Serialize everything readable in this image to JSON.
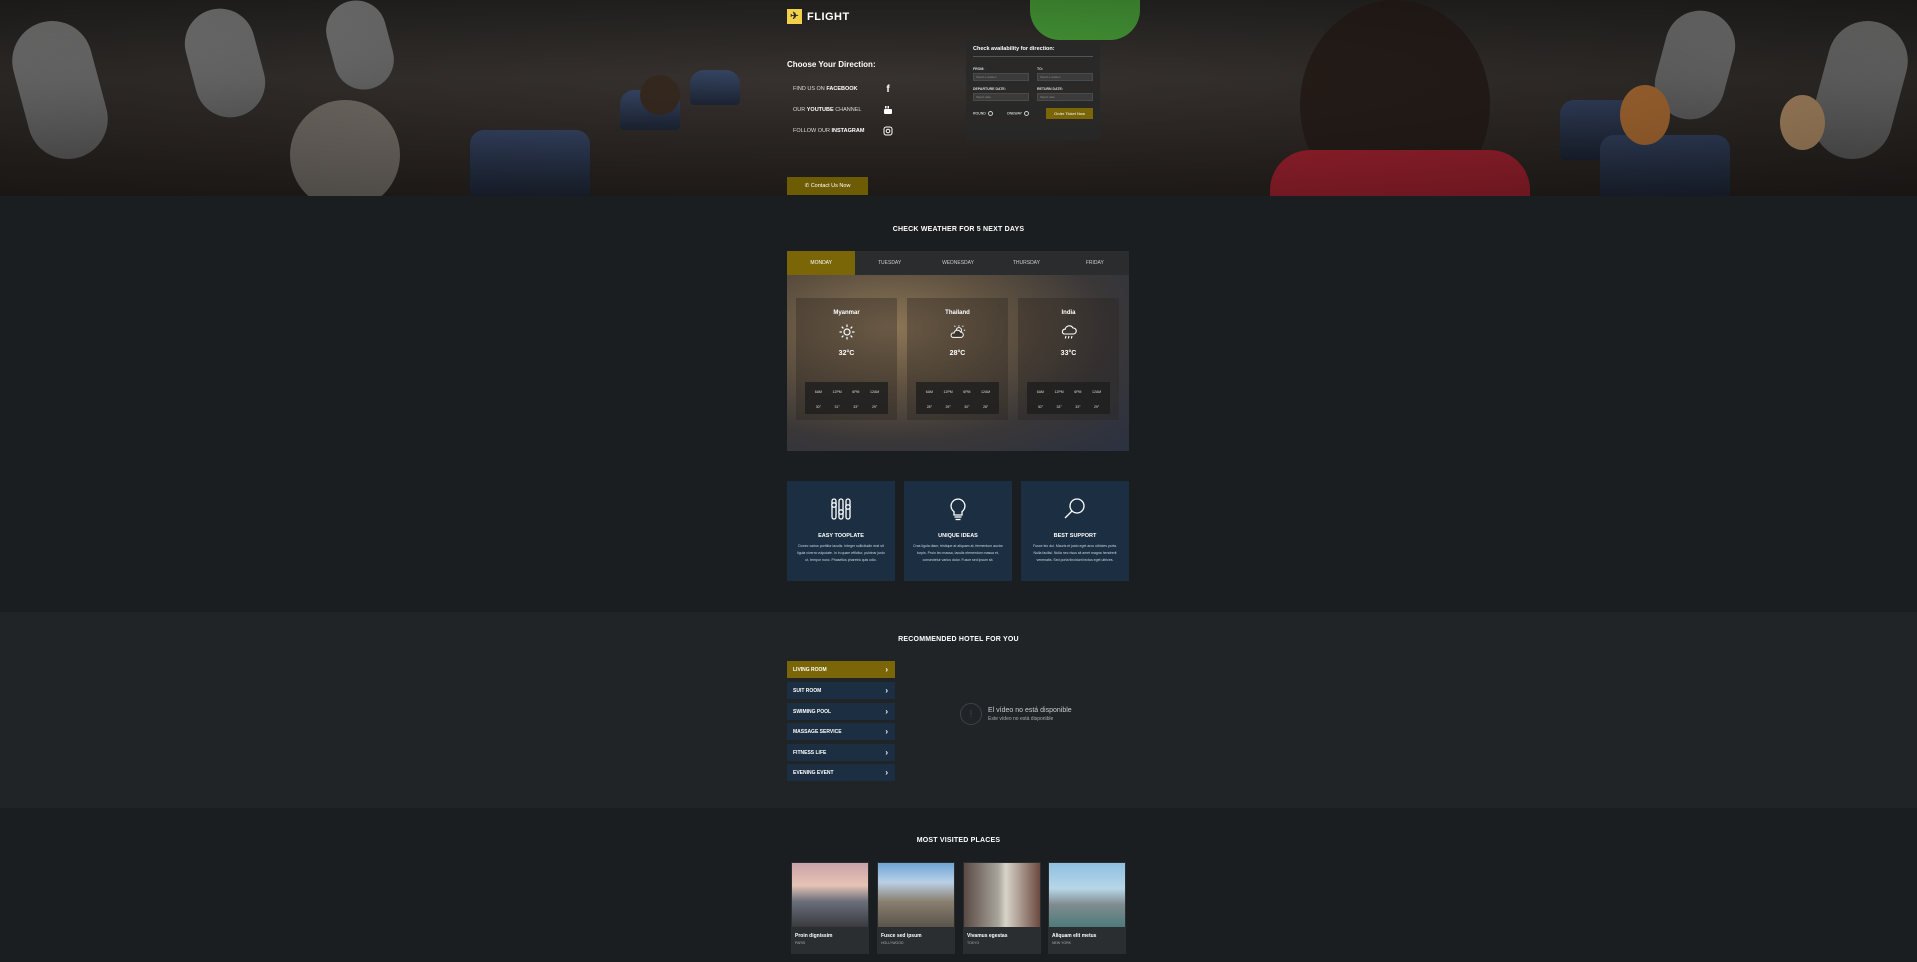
{
  "brand": {
    "logo_glyph": "✈",
    "name": "FLIGHT"
  },
  "hero": {
    "direction_title": "Choose Your Direction:",
    "social": [
      {
        "prefix": "FIND US ON",
        "name": "FACEBOOK",
        "icon": "facebook-icon"
      },
      {
        "prefix": "OUR",
        "name": "YOUTUBE",
        "suffix": "CHANNEL",
        "icon": "youtube-icon"
      },
      {
        "prefix": "FOLLOW OUR",
        "name": "INSTAGRAM",
        "icon": "instagram-icon"
      }
    ],
    "contact_label": "✆ Contact Us Now"
  },
  "booking": {
    "title": "Check availability for direction:",
    "from_label": "FROM:",
    "from_placeholder": "Select Location",
    "to_label": "TO:",
    "to_placeholder": "Select Location",
    "departure_label": "DEPARTURE DATE:",
    "departure_placeholder": "Select date",
    "return_label": "RETURN DATE:",
    "return_placeholder": "Select date",
    "round_label": "ROUND",
    "oneway_label": "ONEWAY",
    "order_label": "Order Ticket Now"
  },
  "weather": {
    "title": "CHECK WEATHER FOR 5 NEXT DAYS",
    "tabs": [
      "MONDAY",
      "TUESDAY",
      "WEDNESDAY",
      "THURSDAY",
      "FRIDAY"
    ],
    "active_tab": "MONDAY",
    "cards": [
      {
        "city": "Myanmar",
        "icon": "sun-icon",
        "temp": "32°C",
        "hours": [
          "6AM",
          "12PM",
          "6PM",
          "12AM"
        ],
        "temps": [
          "30°",
          "31°",
          "33°",
          "29°"
        ]
      },
      {
        "city": "Thailand",
        "icon": "partly-cloudy-icon",
        "temp": "28°C",
        "hours": [
          "6AM",
          "12PM",
          "6PM",
          "12AM"
        ],
        "temps": [
          "28°",
          "29°",
          "30°",
          "28°"
        ]
      },
      {
        "city": "India",
        "icon": "rain-cloud-icon",
        "temp": "33°C",
        "hours": [
          "6AM",
          "12PM",
          "6PM",
          "12AM"
        ],
        "temps": [
          "30°",
          "33°",
          "33°",
          "29°"
        ]
      }
    ]
  },
  "features": [
    {
      "title": "EASY TOOPLATE",
      "icon": "sliders-icon",
      "text": "Donec varius porttitor iaculis. Integer sollicitudin erat sit ligula viverra vulputate. In in quam efficitur, pulvinar justo ut, tempor nunc. Phasellus pharetra quis odio."
    },
    {
      "title": "UNIQUE IDEAS",
      "icon": "lightbulb-icon",
      "text": "Cras ligula diam, tristique at aliquam at, fermentum auctor turpis. Proin leo massa, iaculis elementum massa et, consectetur varius dolor. Fusce sed ipsum sit."
    },
    {
      "title": "BEST SUPPORT",
      "icon": "magnifier-icon",
      "text": "Fusce leo dui. Mauris et justo eget arcu ultricies porta. Nulla facilisi. Nulla nec risus sit amet magna hendrerit venenatis. Sed porta tincidunt lectus eget ultrices."
    }
  ],
  "hotel": {
    "title": "RECOMMENDED HOTEL FOR YOU",
    "items": [
      "LIVING ROOM",
      "SUIT ROOM",
      "SWIMING POOL",
      "MASSAGE SERVICE",
      "FITNESS LIFE",
      "EVENING EVENT"
    ],
    "active_item": "LIVING ROOM",
    "video_title": "El vídeo no está disponible",
    "video_subtitle": "Este vídeo no está disponible"
  },
  "places": {
    "title": "MOST VISITED PLACES",
    "items": [
      {
        "name": "Proin dignissim",
        "sub": "PARIS"
      },
      {
        "name": "Fusce sed ipsum",
        "sub": "HOLLYWOOD"
      },
      {
        "name": "Vivamus egestas",
        "sub": "TOKYO"
      },
      {
        "name": "Aliquam elit metus",
        "sub": "NEW YORK"
      }
    ]
  }
}
